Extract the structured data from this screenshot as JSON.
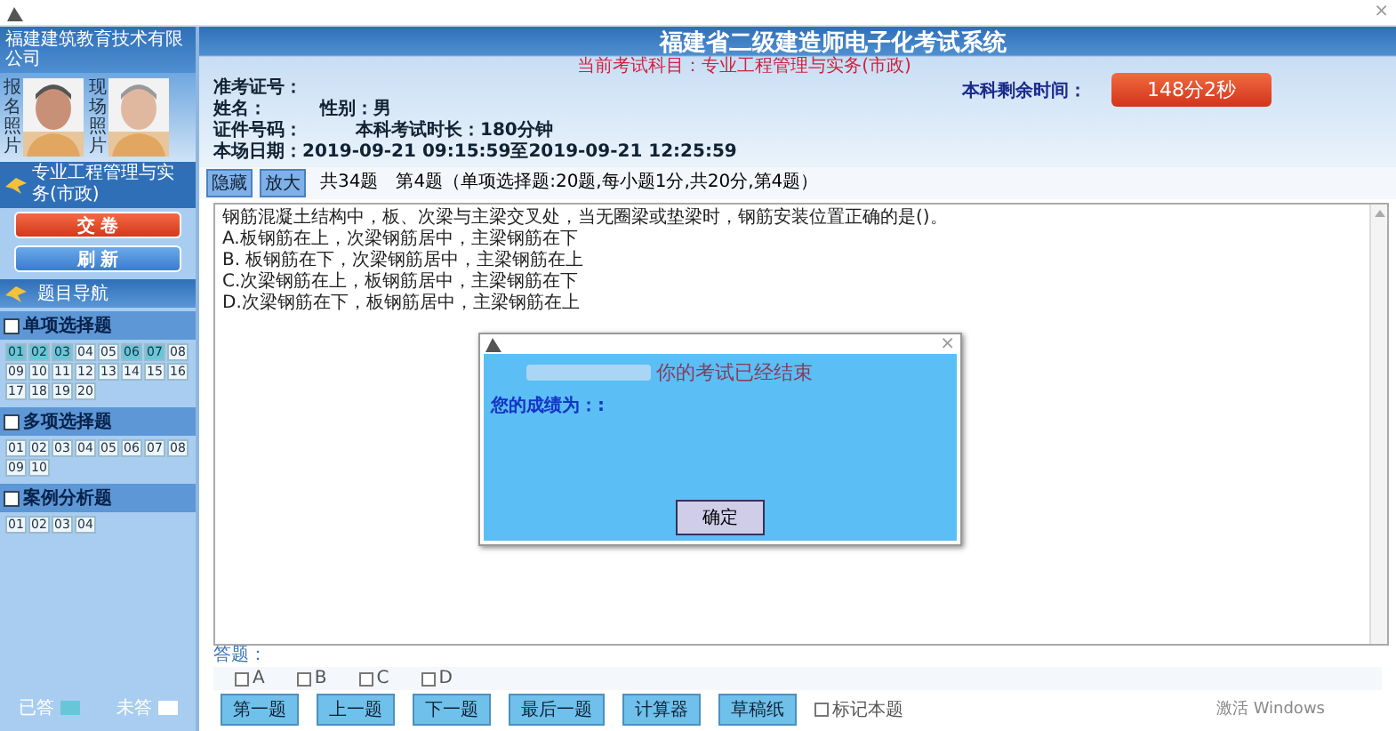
{
  "window": {
    "close": "×"
  },
  "company": "福建建筑教育技术有限公司",
  "photos": [
    {
      "label": "报名照片"
    },
    {
      "label": "现场照片"
    }
  ],
  "sidebar": {
    "subject": "专业工程管理与实务(市政)",
    "buttons": [
      {
        "label": "交 卷",
        "kind": "danger"
      },
      {
        "label": "刷 新",
        "kind": "primary"
      }
    ],
    "nav_title": "题目导航",
    "sections": [
      {
        "title": "单项选择题",
        "items": [
          {
            "number": "01",
            "answered": true
          },
          {
            "number": "02",
            "answered": true
          },
          {
            "number": "03",
            "answered": true
          },
          {
            "number": "04",
            "answered": false
          },
          {
            "number": "05",
            "answered": false
          },
          {
            "number": "06",
            "answered": true
          },
          {
            "number": "07",
            "answered": true
          },
          {
            "number": "08",
            "answered": false
          },
          {
            "number": "09",
            "answered": false
          },
          {
            "number": "10",
            "answered": false
          },
          {
            "number": "11",
            "answered": false
          },
          {
            "number": "12",
            "answered": false
          },
          {
            "number": "13",
            "answered": false
          },
          {
            "number": "14",
            "answered": false
          },
          {
            "number": "15",
            "answered": false
          },
          {
            "number": "16",
            "answered": false
          },
          {
            "number": "17",
            "answered": false
          },
          {
            "number": "18",
            "answered": false
          },
          {
            "number": "19",
            "answered": false
          },
          {
            "number": "20",
            "answered": false
          }
        ]
      },
      {
        "title": "多项选择题",
        "items": [
          {
            "number": "01",
            "answered": false
          },
          {
            "number": "02",
            "answered": false
          },
          {
            "number": "03",
            "answered": false
          },
          {
            "number": "04",
            "answered": false
          },
          {
            "number": "05",
            "answered": false
          },
          {
            "number": "06",
            "answered": false
          },
          {
            "number": "07",
            "answered": false
          },
          {
            "number": "08",
            "answered": false
          },
          {
            "number": "09",
            "answered": false
          },
          {
            "number": "10",
            "answered": false
          }
        ]
      },
      {
        "title": "案例分析题",
        "items": [
          {
            "number": "01",
            "answered": false
          },
          {
            "number": "02",
            "answered": false
          },
          {
            "number": "03",
            "answered": false
          },
          {
            "number": "04",
            "answered": false
          }
        ]
      }
    ],
    "legend": [
      {
        "label": "已答",
        "answered": true
      },
      {
        "label": "未答",
        "answered": false
      }
    ]
  },
  "header": {
    "title": "福建省二级建造师电子化考试系统",
    "subject": "当前考试科目：专业工程管理与实务(市政)",
    "info": [
      [
        "准考证号："
      ],
      [
        "姓名：",
        "性别：男"
      ],
      [
        "证件号码：",
        "本科考试时长：180分钟"
      ],
      [
        "本场日期：2019-09-21 09:15:59至2019-09-21 12:25:59"
      ]
    ],
    "remaining_label": "本科剩余时间：",
    "remaining": "148分2秒"
  },
  "tabs": [
    {
      "label": "隐藏"
    },
    {
      "label": "放大"
    }
  ],
  "question_info": "共34题　第4题（单项选择题:20题,每小题1分,共20分,第4题）",
  "question": {
    "stem": "钢筋混凝土结构中，板、次梁与主梁交叉处，当无圈梁或垫梁时，钢筋安装位置正确的是()。",
    "options": [
      "A.板钢筋在上，次梁钢筋居中，主梁钢筋在下",
      "B. 板钢筋在下，次梁钢筋居中，主梁钢筋在上",
      "C.次梁钢筋在上，板钢筋居中，主梁钢筋在下",
      "D.次梁钢筋在下，板钢筋居中，主梁钢筋在上"
    ]
  },
  "dialog": {
    "message": "你的考试已经结束",
    "score_label": "您的成绩为：:",
    "button": "确定"
  },
  "answer": {
    "label": "答题：",
    "choices": [
      {
        "label": "A",
        "checked": false
      },
      {
        "label": "B",
        "checked": false
      },
      {
        "label": "C",
        "checked": false
      },
      {
        "label": "D",
        "checked": false
      }
    ],
    "buttons": [
      "第一题",
      "上一题",
      "下一题",
      "最后一题",
      "计算器",
      "草稿纸"
    ],
    "mark": {
      "label": "标记本题",
      "checked": false
    }
  },
  "os_notice": "激活 Windows"
}
